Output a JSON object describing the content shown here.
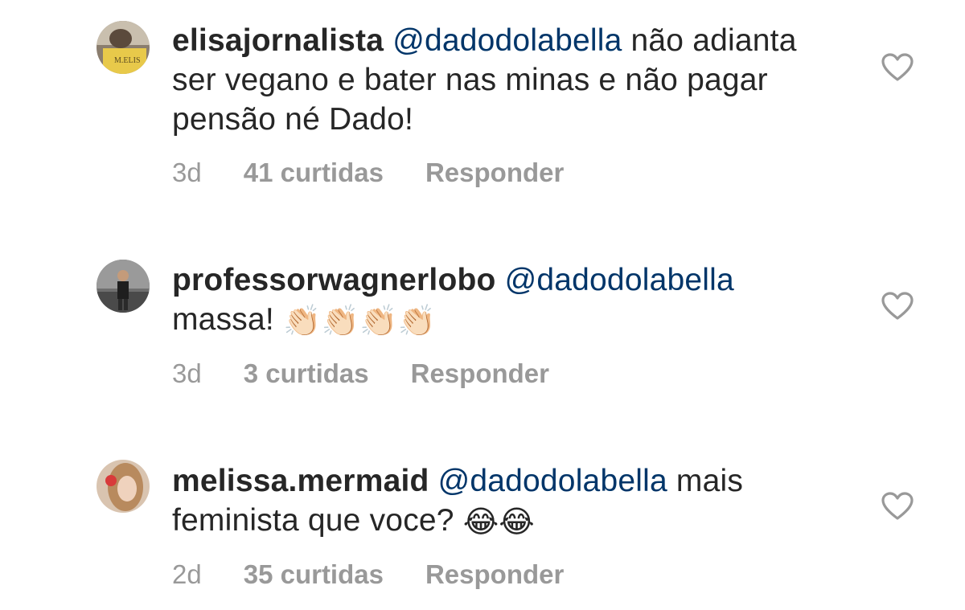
{
  "comments": [
    {
      "username": "elisajornalista",
      "mention": "@dadodolabella",
      "text_line1": " não",
      "text_rest": "adianta ser vegano e bater nas minas e não pagar pensão né Dado!",
      "emojis": "",
      "time": "3d",
      "likes": "41 curtidas",
      "reply": "Responder",
      "avatar_icon": "user-avatar",
      "like_icon": "heart-outline-icon"
    },
    {
      "username": "professorwagnerlobo",
      "mention": "@dadodolabella",
      "text_line1": "",
      "text_rest": "massa! ",
      "emojis": "👏🏻👏🏻👏🏻👏🏻",
      "time": "3d",
      "likes": "3 curtidas",
      "reply": "Responder",
      "avatar_icon": "user-avatar",
      "like_icon": "heart-outline-icon"
    },
    {
      "username": "melissa.mermaid",
      "mention": "@dadodolabella",
      "text_line1": " mais",
      "text_rest": "feminista que voce? ",
      "emojis": "😂😂",
      "time": "2d",
      "likes": "35 curtidas",
      "reply": "Responder",
      "avatar_icon": "user-avatar",
      "like_icon": "heart-outline-icon"
    }
  ],
  "colors": {
    "text": "#262626",
    "mention": "#003569",
    "meta": "#999999",
    "heart": "#999999"
  }
}
